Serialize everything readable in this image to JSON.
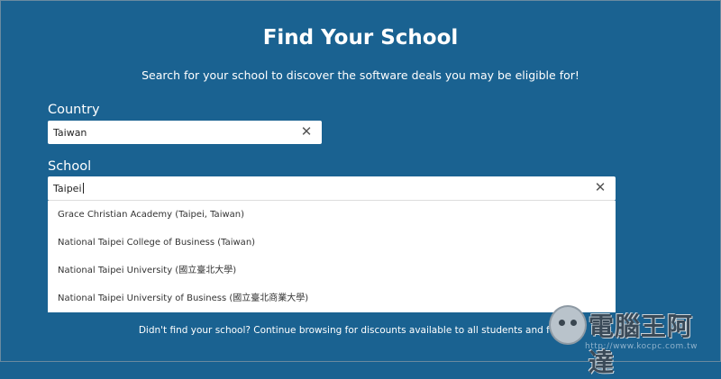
{
  "page": {
    "title": "Find Your School",
    "subtitle": "Search for your school to discover the software deals you may be eligible for!"
  },
  "country": {
    "label": "Country",
    "value": "Taiwan"
  },
  "school": {
    "label": "School",
    "value": "Taipei"
  },
  "suggestions": [
    "Grace Christian Academy (Taipei, Taiwan)",
    "National Taipei College of Business (Taiwan)",
    "National Taipei University (國立臺北大學)",
    "National Taipei University of Business (國立臺北商業大學)"
  ],
  "footer": {
    "text": "Didn't find your school? Continue browsing for discounts available to all students and faculty!"
  },
  "watermark": {
    "logo_text": "電腦王阿達",
    "url": "http://www.kocpc.com.tw"
  },
  "icons": {
    "clear": "close-icon"
  }
}
